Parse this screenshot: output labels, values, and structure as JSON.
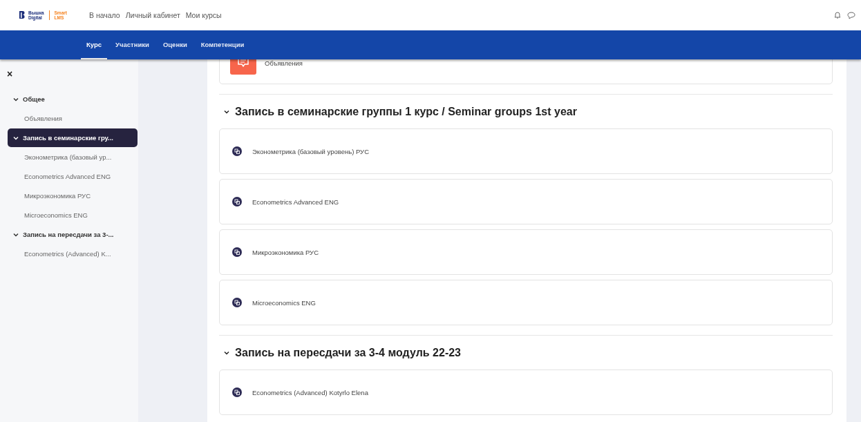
{
  "logo": {
    "brand_top": "Вышка",
    "brand_bottom": "Digital",
    "product_top": "Smart",
    "product_bottom": "LMS"
  },
  "header_links": [
    "В начало",
    "Личный кабинет",
    "Мои курсы"
  ],
  "nav_tabs": [
    {
      "label": "Курс",
      "selected": true
    },
    {
      "label": "Участники",
      "selected": false
    },
    {
      "label": "Оценки",
      "selected": false
    },
    {
      "label": "Компетенции",
      "selected": false
    }
  ],
  "sidebar": {
    "close": "×",
    "sections": [
      {
        "title": "Общее",
        "expanded": true,
        "selected": false,
        "children": [
          {
            "label": "Объявления"
          }
        ]
      },
      {
        "title": "Запись в семинарские гру...",
        "expanded": true,
        "selected": true,
        "children": [
          {
            "label": "Эконометрика (базовый ур..."
          },
          {
            "label": "Econometrics Advanced ENG"
          },
          {
            "label": "Микроэкономика РУС"
          },
          {
            "label": "Microeconomics ENG"
          }
        ]
      },
      {
        "title": "Запись на пересдачи за 3-...",
        "expanded": true,
        "selected": false,
        "children": [
          {
            "label": "Econometrics (Advanced) K..."
          }
        ]
      }
    ]
  },
  "main": {
    "top_activity": {
      "label": "Объявления",
      "kind": "forum"
    },
    "sections": [
      {
        "title": "Запись в семинарские группы 1 курс / Seminar groups 1st year",
        "expanded": true,
        "activities": [
          {
            "label": "Эконометрика (базовый уровень) РУС",
            "kind": "choice"
          },
          {
            "label": "Econometrics Advanced ENG",
            "kind": "choice"
          },
          {
            "label": "Микроэкономика РУС",
            "kind": "choice"
          },
          {
            "label": "Microeconomics ENG",
            "kind": "choice"
          }
        ]
      },
      {
        "title": "Запись на пересдачи за 3-4 модуль 22-23",
        "expanded": true,
        "activities": [
          {
            "label": "Econometrics (Advanced) Kotyrlo Elena",
            "kind": "choice"
          }
        ]
      }
    ]
  }
}
